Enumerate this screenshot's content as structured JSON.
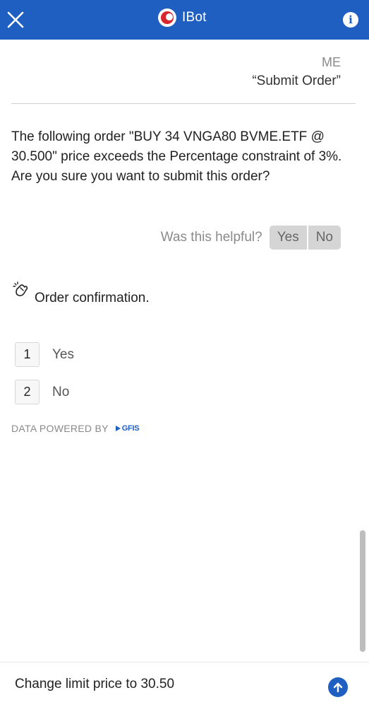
{
  "header": {
    "title": "IBot",
    "close_icon": "close-icon",
    "info_icon": "info-icon",
    "info_glyph": "i"
  },
  "user_message": {
    "sender": "ME",
    "text": "“Submit Order”"
  },
  "bot_message": {
    "text": "The following order \"BUY 34 VNGA80 BVME.ETF @ 30.500\" price exceeds the Percentage constraint of 3%. Are you sure you want to submit this order?",
    "feedback_question": "Was this helpful?",
    "feedback_yes": "Yes",
    "feedback_no": "No"
  },
  "confirmation": {
    "icon": "hand-wave-icon",
    "title": "Order confirmation.",
    "options": [
      {
        "number": "1",
        "label": "Yes"
      },
      {
        "number": "2",
        "label": "No"
      }
    ]
  },
  "powered_by": {
    "text": "DATA POWERED BY",
    "brand": "GFIS"
  },
  "composer": {
    "value": "Change limit price to 30.50",
    "send_icon": "arrow-up-icon"
  },
  "colors": {
    "header_bg": "#1f5fc2",
    "accent": "#1f5fc2",
    "logo_red": "#d8262e"
  }
}
